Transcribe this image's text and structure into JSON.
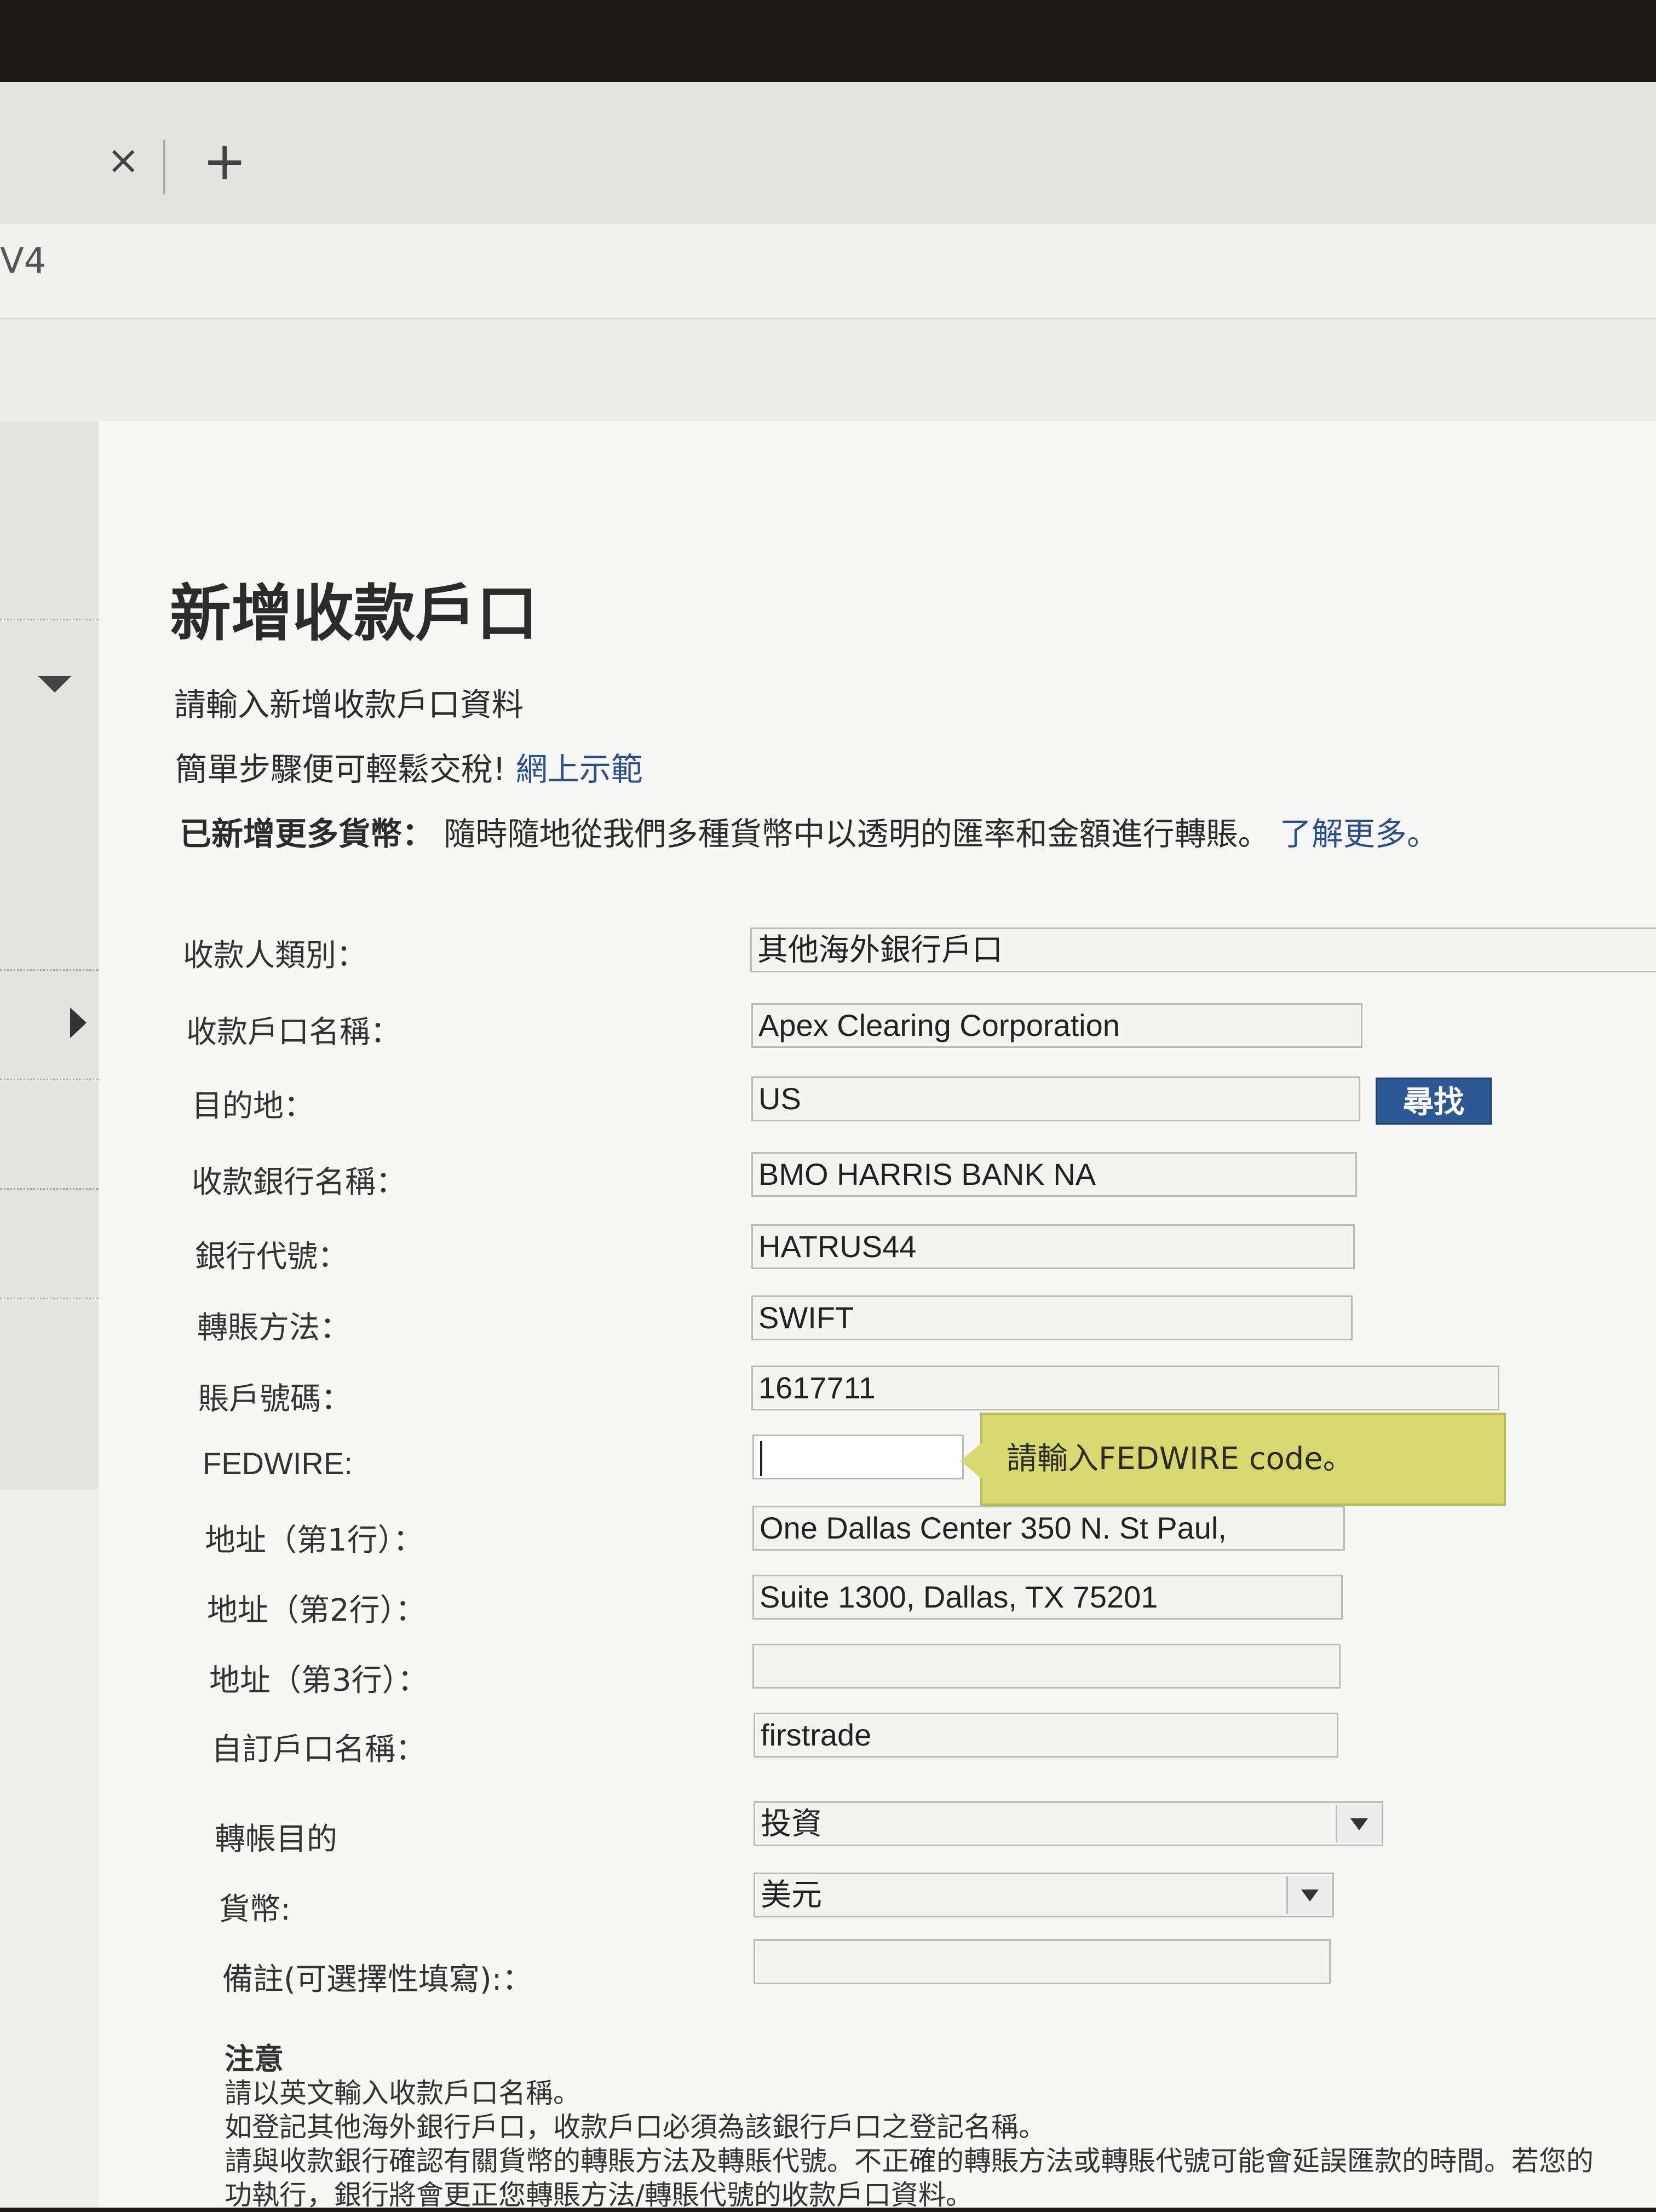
{
  "browser": {
    "tab_close": "×",
    "tab_add": "+",
    "url_fragment": "V4"
  },
  "page": {
    "title": "新增收款戶口",
    "intro": "請輸入新增收款戶口資料",
    "help_text": "簡單步驟便可輕鬆交稅!",
    "help_link": "網上示範",
    "promo_bold": "已新增更多貨幣：",
    "promo_text": "隨時隨地從我們多種貨幣中以透明的匯率和金額進行轉賬。",
    "promo_link": "了解更多。"
  },
  "form": {
    "payee_type_label": "收款人類別：",
    "payee_type_value": "其他海外銀行戶口",
    "account_name_label": "收款戶口名稱：",
    "account_name_value": "Apex Clearing Corporation",
    "destination_label": "目的地：",
    "destination_value": "US",
    "search_button": "尋找",
    "bank_name_label": "收款銀行名稱：",
    "bank_name_value": "BMO HARRIS BANK NA",
    "bank_code_label": "銀行代號：",
    "bank_code_value": "HATRUS44",
    "method_label": "轉賬方法：",
    "method_value": "SWIFT",
    "account_no_label": "賬戶號碼：",
    "account_no_value": "1617711",
    "fedwire_label": "FEDWIRE:",
    "fedwire_value": "",
    "fedwire_tooltip": "請輸入FEDWIRE code。",
    "address1_label": "地址（第1行）：",
    "address1_value": "One Dallas Center 350 N. St Paul,",
    "address2_label": "地址（第2行）：",
    "address2_value": "Suite 1300, Dallas, TX 75201",
    "address3_label": "地址（第3行）：",
    "address3_value": "",
    "nickname_label": "自訂戶口名稱：",
    "nickname_value": "firstrade",
    "purpose_label": "轉帳目的",
    "purpose_value": "投資",
    "currency_label": "貨幣:",
    "currency_value": "美元",
    "remarks_label": "備註(可選擇性填寫):：",
    "remarks_value": ""
  },
  "notes": {
    "title": "注意",
    "line1": "請以英文輸入收款戶口名稱。",
    "line2": "如登記其他海外銀行戶口，收款戶口必須為該銀行戶口之登記名稱。",
    "line3": "請與收款銀行確認有關貨幣的轉賬方法及轉賬代號。不正確的轉賬方法或轉賬代號可能會延誤匯款的時間。若您的",
    "line4": "功執行，銀行將會更正您轉賬方法/轉賬代號的收款戶口資料。"
  }
}
